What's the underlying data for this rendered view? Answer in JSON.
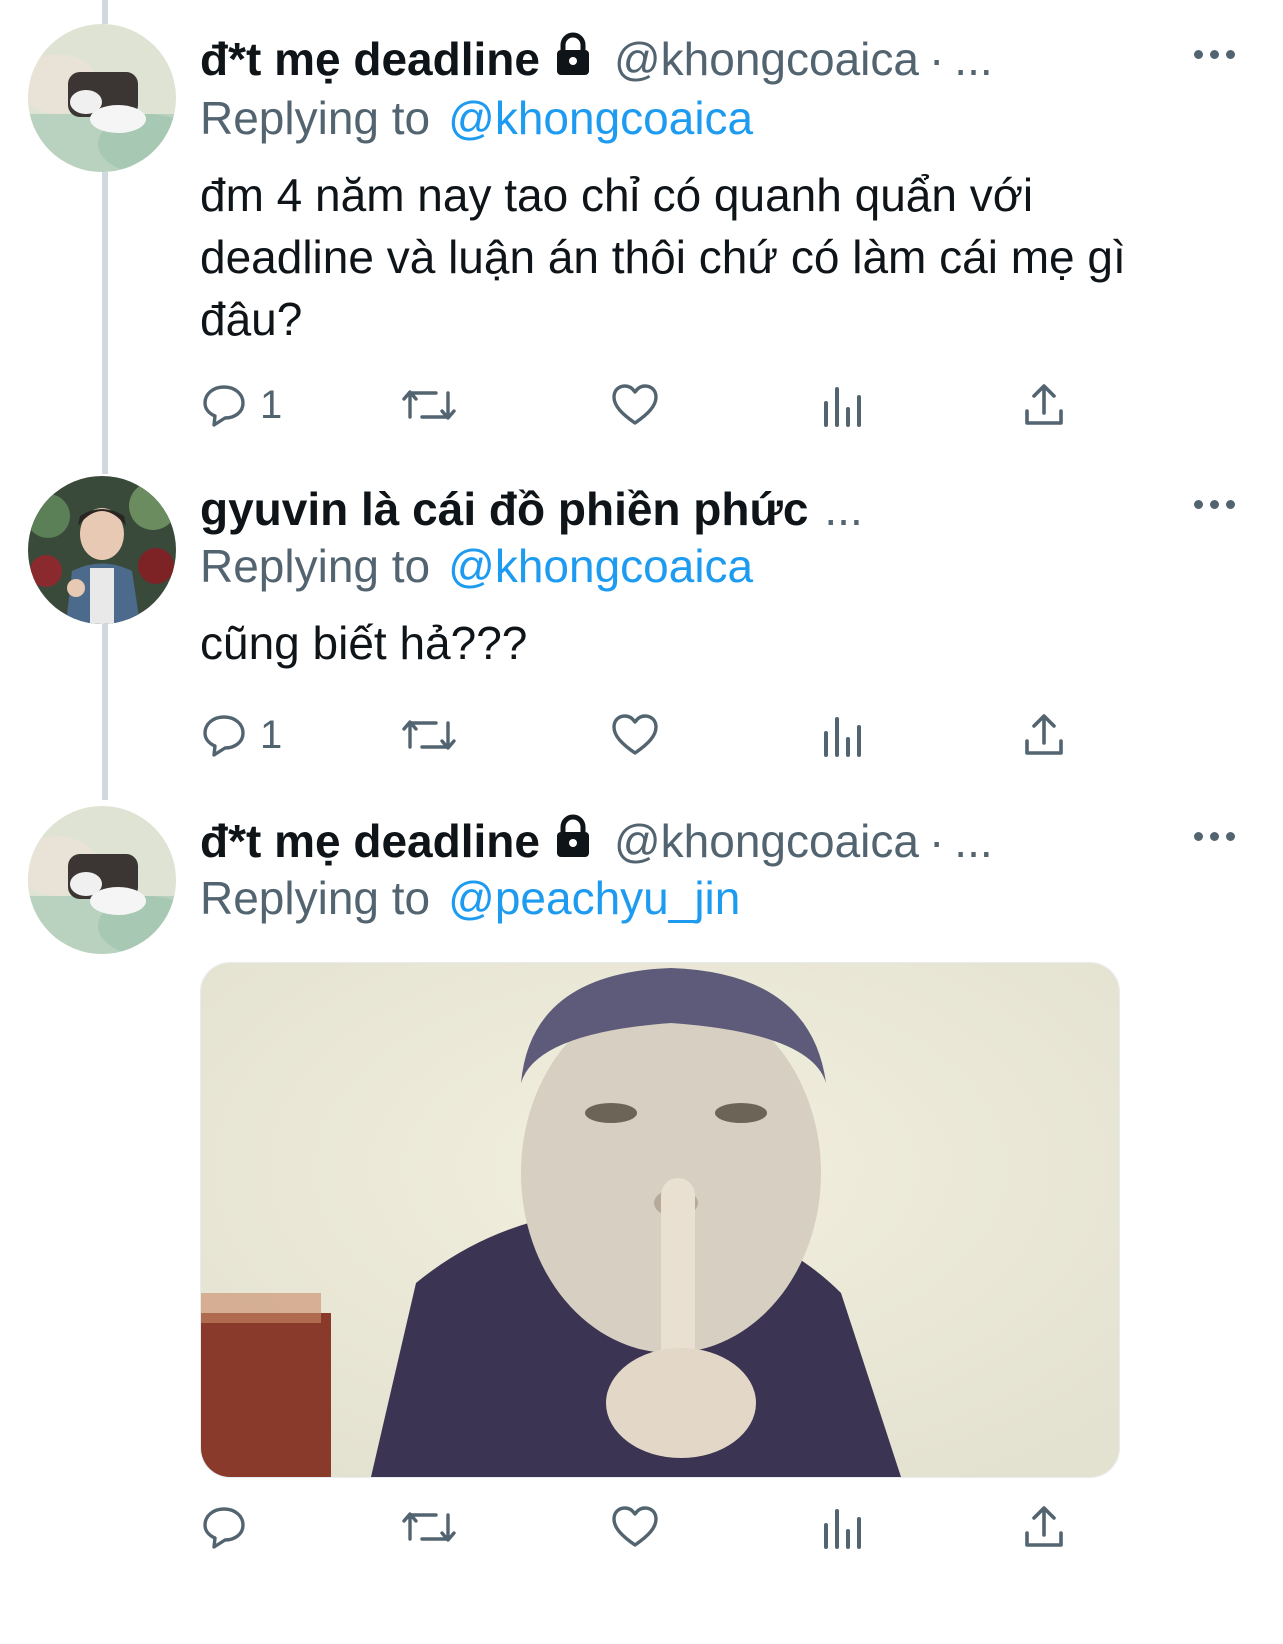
{
  "tweets": [
    {
      "display_name": "đ*t mẹ deadline",
      "handle": "@khongcoaica",
      "separator": "·",
      "truncation": "...",
      "replying_prefix": "Replying to",
      "replying_to": "@khongcoaica",
      "text": "đm 4 năm nay tao chỉ có quanh quẩn với deadline và luận án thôi chứ có làm cái mẹ gì đâu?",
      "reply_count": "1",
      "protected": true
    },
    {
      "display_name": "gyuvin là cái đồ phiền phức",
      "truncation": "...",
      "replying_prefix": "Replying to",
      "replying_to": "@khongcoaica",
      "text": "cũng biết hả???",
      "reply_count": "1"
    },
    {
      "display_name": "đ*t mẹ deadline",
      "handle": "@khongcoaica",
      "separator": "·",
      "truncation": "...",
      "replying_prefix": "Replying to",
      "replying_to": "@peachyu_jin",
      "has_media": true,
      "protected": true
    }
  ],
  "icons": [
    "reply-icon",
    "retweet-icon",
    "like-icon",
    "analytics-icon",
    "share-icon",
    "lock-icon",
    "more-icon"
  ],
  "colors": {
    "link": "#1d9bf0",
    "secondary": "#536471",
    "primary_text": "#0f1419",
    "thread_line": "#cfd9de"
  }
}
